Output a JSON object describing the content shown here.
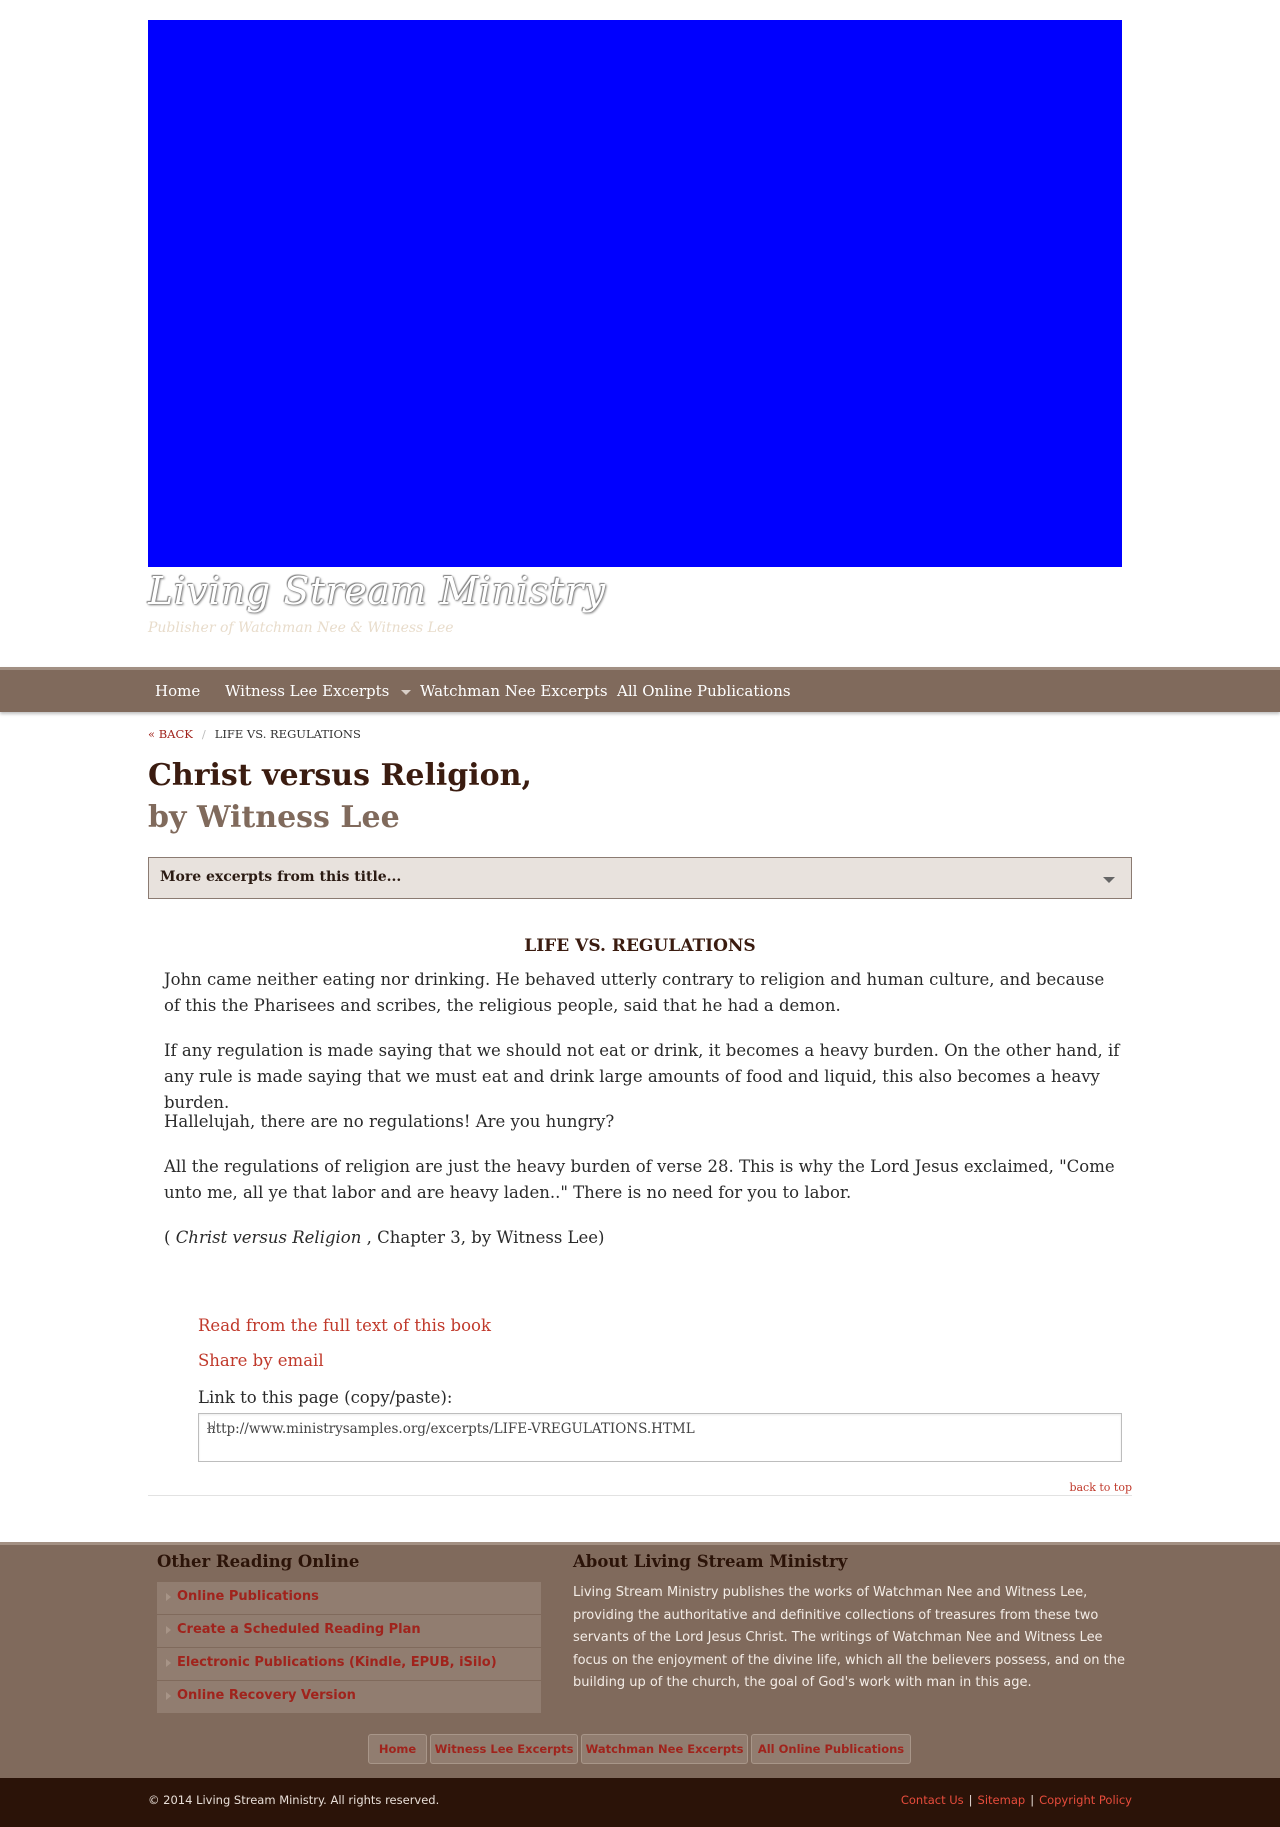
{
  "colors": {
    "banner": "#0000ff",
    "nav_background": "#806a5c",
    "accent_link": "#c0392b",
    "heading_dark": "#3b1c10",
    "footer_background": "#806a5c",
    "bottom_bar": "#2b1308"
  },
  "site": {
    "title": "Living Stream Ministry",
    "tagline": "Publisher of Watchman Nee & Witness Lee"
  },
  "nav": {
    "items": [
      {
        "label": "Home"
      },
      {
        "label": "Witness Lee Excerpts",
        "icon": "caret-down-icon"
      },
      {
        "label": "Watchman Nee Excerpts"
      },
      {
        "label": "All Online Publications"
      }
    ]
  },
  "breadcrumb": {
    "back": "« BACK",
    "separator": "/",
    "current": "LIFE VS. REGULATIONS"
  },
  "book": {
    "title": "Christ versus Religion,",
    "author": "by Witness Lee"
  },
  "excerpts_dropdown": {
    "label": "More excerpts from this title...",
    "icon": "caret-down-icon"
  },
  "excerpt": {
    "heading": "LIFE VS. REGULATIONS",
    "paragraphs": [
      "John came neither eating nor drinking. He behaved utterly contrary to religion and human culture, and because of this the Pharisees and scribes, the religious people, said that he had a demon.",
      "If any regulation is made saying that we should not eat or drink, it becomes a heavy burden. On the other hand, if any rule is made saying that we must eat and drink large amounts of food and liquid, this also becomes a heavy burden.",
      "Hallelujah, there are no regulations! Are you hungry?",
      "All the regulations of religion are just the heavy burden of verse 28. This is why the Lord Jesus exclaimed, \"Come unto me, all ye that labor and are heavy laden..\" There is no need for you to labor."
    ],
    "citation": {
      "open": "( ",
      "book_title": "Christ versus Religion",
      "rest": " , Chapter 3, by Witness Lee)"
    }
  },
  "actions": {
    "read_full": "Read from the full text of this book",
    "share_email": "Share by email",
    "link_label": "Link to this page (copy/paste):",
    "link_value": "http://www.ministrysamples.org/excerpts/LIFE-VREGULATIONS.HTML",
    "back_to_top": "back to top"
  },
  "footer": {
    "other_reading": {
      "heading": "Other Reading Online",
      "items": [
        "Online Publications",
        "Create a Scheduled Reading Plan",
        "Electronic Publications (Kindle, EPUB, iSilo)",
        "Online Recovery Version"
      ]
    },
    "about": {
      "heading": "About Living Stream Ministry",
      "text": "Living Stream Ministry publishes the works of Watchman Nee and Witness Lee, providing the authoritative and definitive collections of treasures from these two servants of the Lord Jesus Christ. The writings of Watchman Nee and Witness Lee focus on the enjoyment of the divine life, which all the believers possess, and on the building up of the church, the goal of God's work with man in this age."
    },
    "nav_pills": [
      "Home",
      "Witness Lee Excerpts",
      "Watchman Nee Excerpts",
      "All Online Publications"
    ],
    "copyright": "© 2014 Living Stream Ministry. All rights reserved.",
    "bottom_links": [
      "Contact Us",
      "Sitemap",
      "Copyright Policy"
    ],
    "bottom_separator": "|"
  }
}
